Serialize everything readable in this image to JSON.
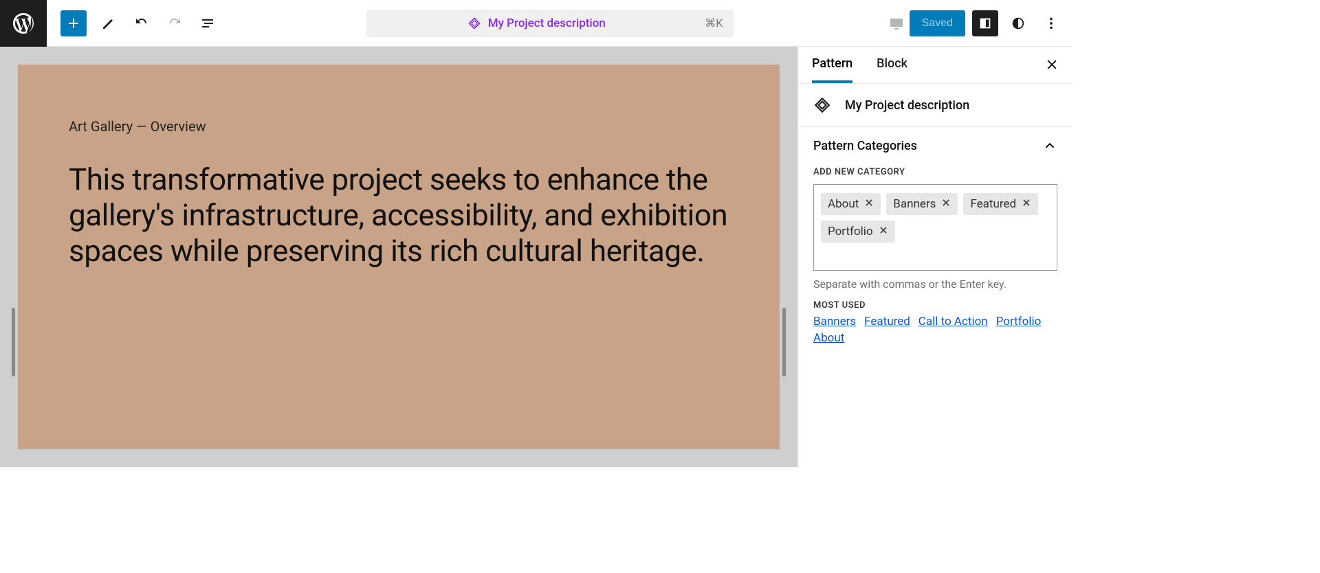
{
  "toolbar": {
    "command_title": "My Project description",
    "shortcut": "⌘K",
    "save_label": "Saved"
  },
  "canvas": {
    "label": "Art Gallery — Overview",
    "body": "This transformative project seeks to enhance the gallery's infrastructure, accessibility, and exhibition spaces while preserving its rich cultural heritage."
  },
  "sidebar": {
    "tabs": {
      "pattern": "Pattern",
      "block": "Block"
    },
    "pattern_name": "My Project description",
    "panel": {
      "categories_label": "Pattern Categories",
      "add_new_label": "Add New Category",
      "chips": [
        "About",
        "Banners",
        "Featured",
        "Portfolio"
      ],
      "hint": "Separate with commas or the Enter key.",
      "most_used_label": "Most Used",
      "most_used": [
        "Banners",
        "Featured",
        "Call to Action",
        "Portfolio",
        "About"
      ]
    }
  },
  "colors": {
    "accent": "#007cba",
    "canvas_bg": "#c8a387",
    "command_purple": "#8a2be2"
  }
}
